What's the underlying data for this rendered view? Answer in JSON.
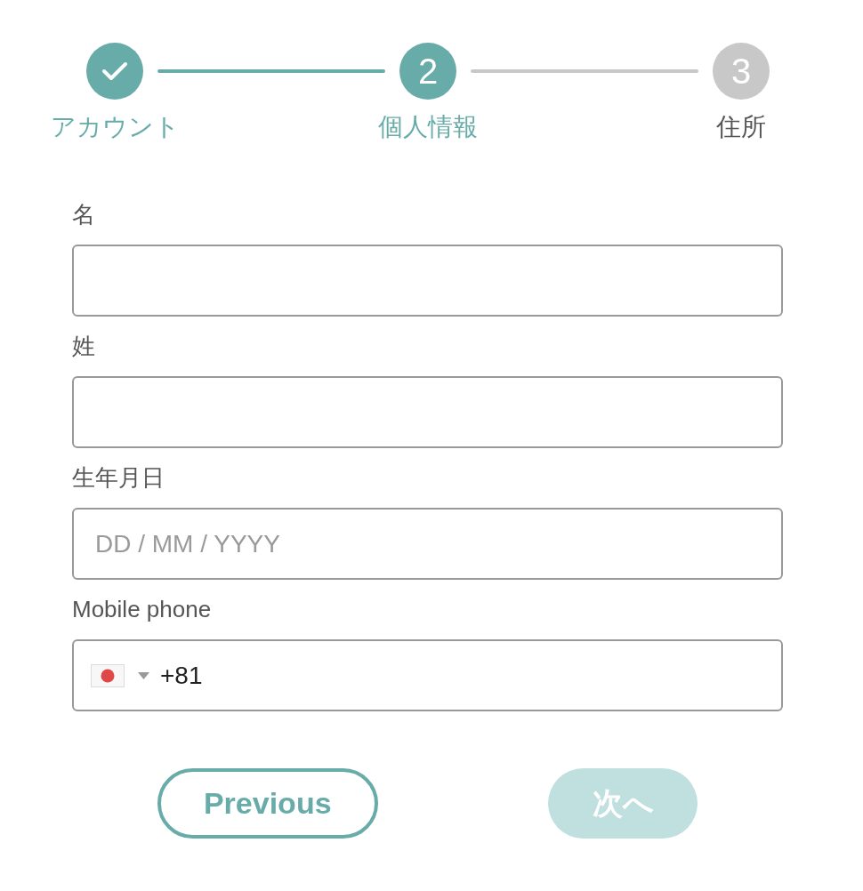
{
  "steps": [
    {
      "label": "アカウント",
      "completed": true,
      "selected": false
    },
    {
      "number": "2",
      "label": "個人情報",
      "completed": false,
      "selected": true
    },
    {
      "number": "3",
      "label": "住所",
      "completed": false,
      "selected": false
    }
  ],
  "fields": [
    {
      "kind": "text",
      "label": "名"
    },
    {
      "kind": "text",
      "label": "姓"
    },
    {
      "kind": "date",
      "label": "生年月日",
      "placeholder": "DD / MM / YYYY"
    },
    {
      "kind": "phone",
      "label": "Mobile phone",
      "value": "+81"
    }
  ],
  "buttons": [
    {
      "kind": "outline",
      "label": "Previous",
      "disabled": false
    },
    {
      "kind": "filled",
      "label": "次へ",
      "disabled": true
    }
  ]
}
